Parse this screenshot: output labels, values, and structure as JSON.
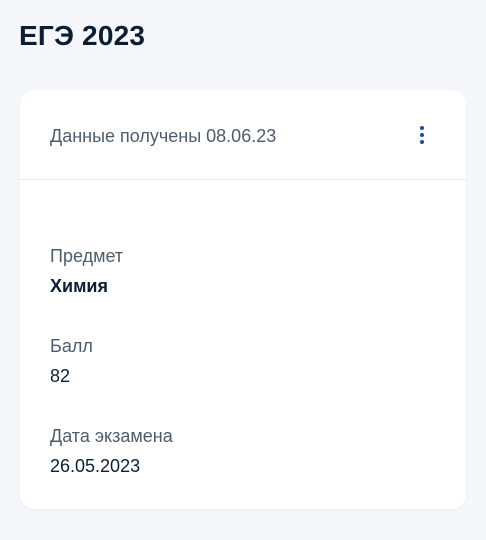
{
  "page": {
    "title": "ЕГЭ 2023"
  },
  "card": {
    "header": {
      "data_received": "Данные получены 08.06.23",
      "menu_icon": "more-vertical-icon"
    },
    "fields": {
      "subject": {
        "label": "Предмет",
        "value": "Химия"
      },
      "score": {
        "label": "Балл",
        "value": "82"
      },
      "exam_date": {
        "label": "Дата экзамена",
        "value": "26.05.2023"
      }
    }
  },
  "colors": {
    "background": "#f5f7fa",
    "card": "#ffffff",
    "text_primary": "#0b1f33",
    "text_secondary": "#4d5c6c",
    "accent": "#1a4da3",
    "divider": "#e3e8ee"
  }
}
